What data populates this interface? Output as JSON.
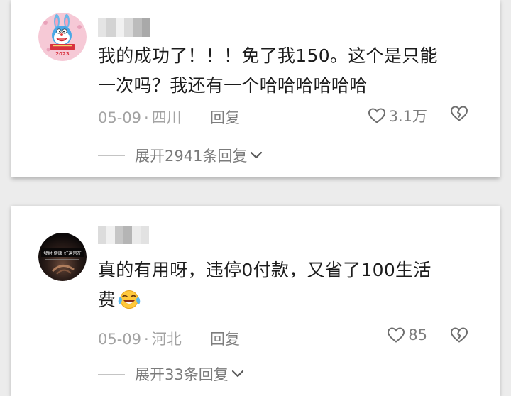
{
  "comments": [
    {
      "text_line1": "我的成功了！！！免了我150。这个是只能",
      "text_line2": "一次吗？我还有一个哈哈哈哈哈哈",
      "date": "05-09",
      "location": "四川",
      "reply_label": "回复",
      "likes": "3.1万",
      "expand_label": "展开2941条回复",
      "avatar_icon": "doraemon-rabbit-avatar",
      "avatar_caption": "2023"
    },
    {
      "text_line1": "真的有用呀，违停0付款，又省了100生活",
      "text_line2": "费",
      "emoji": "laughing-crying-emoji",
      "date": "05-09",
      "location": "河北",
      "reply_label": "回复",
      "likes": "85",
      "expand_label": "展开33条回复",
      "avatar_icon": "dark-photo-avatar",
      "avatar_caption": "發財 健康 好運常在"
    }
  ],
  "meta_separator": "·",
  "colors": {
    "background": "#ececec",
    "card": "#ffffff",
    "text": "#1c1c1c",
    "meta": "#a3a3a3"
  }
}
